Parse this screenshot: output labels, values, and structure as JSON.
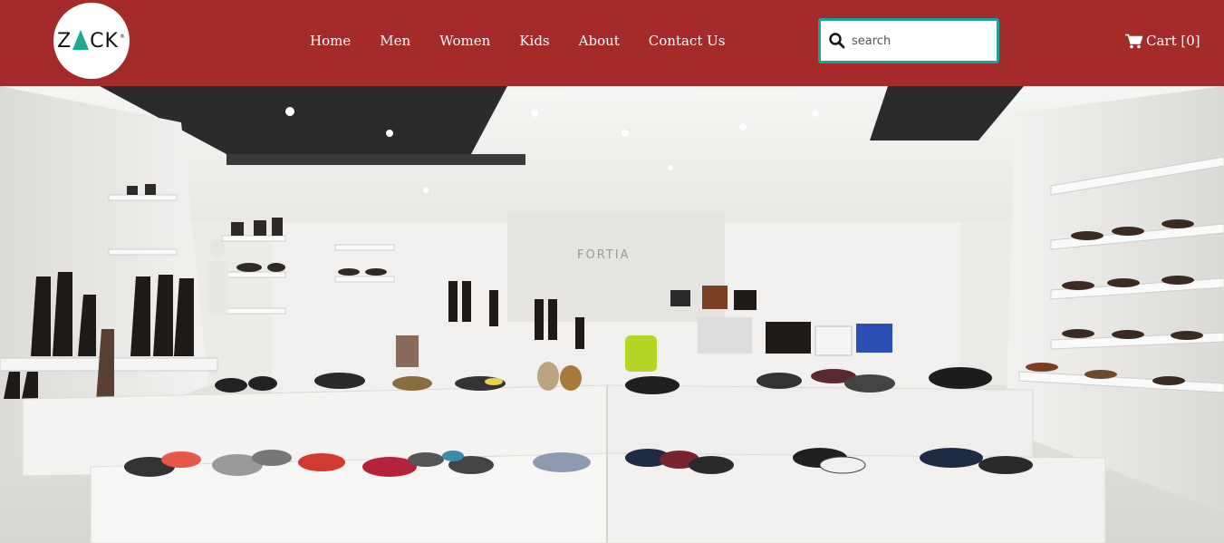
{
  "header": {
    "background_color": "#a52a2a",
    "logo": {
      "text_before": "Z",
      "text_after": "CK",
      "registered": "®",
      "accent_color": "#1fa896"
    },
    "nav": [
      {
        "label": "Home"
      },
      {
        "label": "Men"
      },
      {
        "label": "Women"
      },
      {
        "label": "Kids"
      },
      {
        "label": "About"
      },
      {
        "label": "Contact Us"
      }
    ],
    "search": {
      "placeholder": "search",
      "value": "",
      "icon": "search-icon",
      "border_color": "#1aa39a"
    },
    "cart": {
      "icon": "shopping-cart-icon",
      "label": "Cart [0]"
    }
  },
  "hero": {
    "image": "shoe-store-interior",
    "store_sign": "FORTIA"
  }
}
